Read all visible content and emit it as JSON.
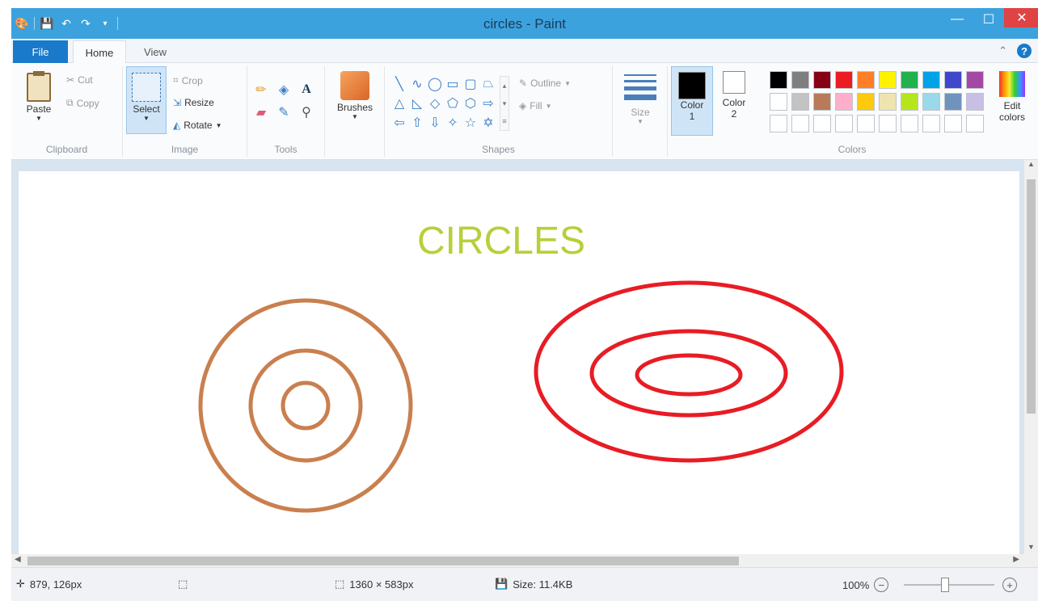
{
  "window": {
    "title": "circles - Paint"
  },
  "tabs": {
    "file": "File",
    "home": "Home",
    "view": "View"
  },
  "clipboard": {
    "paste": "Paste",
    "cut": "Cut",
    "copy": "Copy",
    "group": "Clipboard"
  },
  "image": {
    "select": "Select",
    "crop": "Crop",
    "resize": "Resize",
    "rotate": "Rotate",
    "group": "Image"
  },
  "tools": {
    "group": "Tools"
  },
  "brushes": {
    "label": "Brushes"
  },
  "shapes": {
    "outline": "Outline",
    "fill": "Fill",
    "group": "Shapes"
  },
  "size": {
    "label": "Size"
  },
  "colors": {
    "color1": "Color 1",
    "color1_value": "#000000",
    "color2": "Color 2",
    "color2_value": "#ffffff",
    "edit": "Edit colors",
    "group": "Colors",
    "palette_row1": [
      "#000000",
      "#7f7f7f",
      "#880015",
      "#ed1c24",
      "#ff7f27",
      "#fff200",
      "#22b14c",
      "#00a2e8",
      "#3f48cc",
      "#a349a4"
    ],
    "palette_row2": [
      "#ffffff",
      "#c3c3c3",
      "#b97a57",
      "#ffaec9",
      "#ffc90e",
      "#efe4b0",
      "#b5e61d",
      "#99d9ea",
      "#7092be",
      "#c8bfe7"
    ]
  },
  "canvas": {
    "heading": "CIRCLES",
    "heading_color": "#b8cf3a",
    "left_color": "#c97f4e",
    "right_color": "#e81c24"
  },
  "status": {
    "cursor": "879, 126px",
    "dimensions": "1360 × 583px",
    "size": "Size: 11.4KB",
    "zoom": "100%"
  }
}
